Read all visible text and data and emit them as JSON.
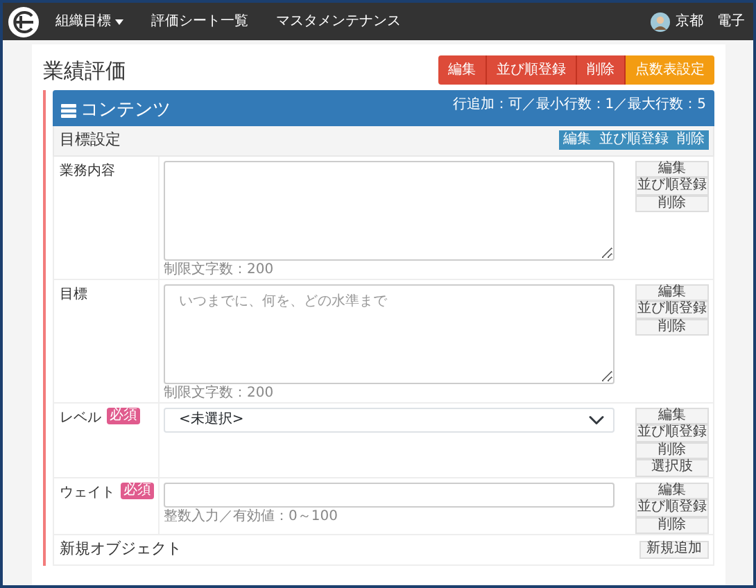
{
  "navbar": {
    "menu": [
      {
        "label": "組織目標",
        "dropdown": true
      },
      {
        "label": "評価シート一覧",
        "dropdown": false
      },
      {
        "label": "マスタメンテナンス",
        "dropdown": false
      }
    ],
    "user_name": "京都　電子"
  },
  "page": {
    "title": "業績評価",
    "actions": [
      {
        "label": "編集",
        "kind": "danger"
      },
      {
        "label": "並び順登録",
        "kind": "danger"
      },
      {
        "label": "削除",
        "kind": "danger"
      },
      {
        "label": "点数表設定",
        "kind": "warning"
      }
    ]
  },
  "panel": {
    "title": "コンテンツ",
    "info": "行追加：可／最小行数：1／最大行数：5"
  },
  "section": {
    "title": "目標設定",
    "actions": [
      "編集",
      "並び順登録",
      "削除"
    ]
  },
  "fields": [
    {
      "label": "業務内容",
      "required": false,
      "kind": "textarea",
      "hint": "制限文字数：200",
      "actions": [
        "編集",
        "並び順登録",
        "削除"
      ]
    },
    {
      "label": "目標",
      "required": false,
      "kind": "textarea",
      "placeholder": "いつまでに、何を、どの水準まで",
      "hint": "制限文字数：200",
      "actions": [
        "編集",
        "並び順登録",
        "削除"
      ]
    },
    {
      "label": "レベル",
      "required": true,
      "required_label": "必須",
      "kind": "select",
      "value": "<未選択>",
      "actions": [
        "編集",
        "並び順登録",
        "削除",
        "選択肢"
      ]
    },
    {
      "label": "ウェイト",
      "required": true,
      "required_label": "必須",
      "kind": "input",
      "hint": "整数入力／有効値：0～100",
      "actions": [
        "編集",
        "並び順登録",
        "削除"
      ]
    }
  ],
  "footer": {
    "label": "新規オブジェクト",
    "button": "新規追加"
  }
}
